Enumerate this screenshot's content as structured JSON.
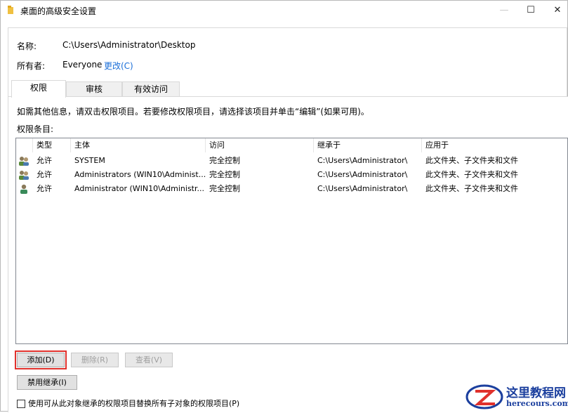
{
  "window": {
    "title": "桌面的高级安全设置",
    "minimize": "—",
    "maximize": "☐",
    "close": "✕"
  },
  "info": {
    "name_label": "名称:",
    "name_value": "C:\\Users\\Administrator\\Desktop",
    "owner_label": "所有者:",
    "owner_value": "Everyone",
    "change_link": "更改(C)"
  },
  "tabs": [
    {
      "label": "权限"
    },
    {
      "label": "审核"
    },
    {
      "label": "有效访问"
    }
  ],
  "permissions": {
    "hint": "如需其他信息，请双击权限项目。若要修改权限项目，请选择该项目并单击“编辑”(如果可用)。",
    "list_label": "权限条目:",
    "columns": [
      "类型",
      "主体",
      "访问",
      "继承于",
      "应用于"
    ],
    "rows": [
      {
        "icon": "user-group-icon",
        "type": "允许",
        "principal": "SYSTEM",
        "access": "完全控制",
        "inherited": "C:\\Users\\Administrator\\",
        "applies": "此文件夹、子文件夹和文件"
      },
      {
        "icon": "user-group-icon",
        "type": "允许",
        "principal": "Administrators (WIN10\\Administ...",
        "access": "完全控制",
        "inherited": "C:\\Users\\Administrator\\",
        "applies": "此文件夹、子文件夹和文件"
      },
      {
        "icon": "user-icon",
        "type": "允许",
        "principal": "Administrator (WIN10\\Administr...",
        "access": "完全控制",
        "inherited": "C:\\Users\\Administrator\\",
        "applies": "此文件夹、子文件夹和文件"
      }
    ]
  },
  "buttons": {
    "add": "添加(D)",
    "remove": "删除(R)",
    "view": "查看(V)",
    "disable_inherit": "禁用继承(I)"
  },
  "checkbox_label": "使用可从此对象继承的权限项目替换所有子对象的权限项目(P)",
  "watermark": {
    "title": "这里教程网",
    "url": "herecours.com"
  },
  "colors": {
    "link": "#1a6ed8",
    "highlight": "#e0312c",
    "watermark": "#1b3f9e"
  }
}
